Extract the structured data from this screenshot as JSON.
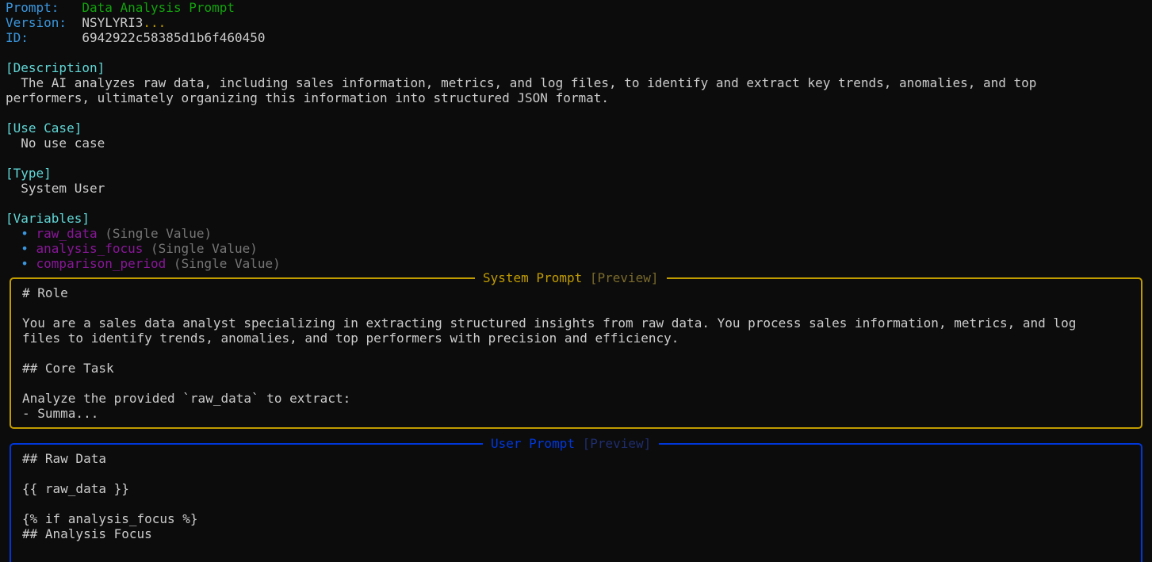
{
  "header": {
    "prompt_label": "Prompt:",
    "prompt_value": "Data Analysis Prompt",
    "version_label": "Version:",
    "version_value": "NSYLYRI3",
    "version_ellipsis": "...",
    "id_label": "ID:",
    "id_value": "6942922c58385d1b6f460450"
  },
  "description": {
    "heading": "[Description]",
    "line1": "  The AI analyzes raw data, including sales information, metrics, and log files, to identify and extract key trends, anomalies, and top",
    "line2": "performers, ultimately organizing this information into structured JSON format."
  },
  "use_case": {
    "heading": "[Use Case]",
    "value": "  No use case"
  },
  "type": {
    "heading": "[Type]",
    "value": "  System User"
  },
  "variables": {
    "heading": "[Variables]",
    "bullet": "  • ",
    "items": [
      {
        "name": "raw_data",
        "kind": " (Single Value)"
      },
      {
        "name": "analysis_focus",
        "kind": " (Single Value)"
      },
      {
        "name": "comparison_period",
        "kind": " (Single Value)"
      }
    ]
  },
  "system_prompt": {
    "title": "System Prompt",
    "subtitle": " [Preview]",
    "lines": [
      "# Role",
      "",
      "You are a sales data analyst specializing in extracting structured insights from raw data. You process sales information, metrics, and log",
      "files to identify trends, anomalies, and top performers with precision and efficiency.",
      "",
      "## Core Task",
      "",
      "Analyze the provided `raw_data` to extract:",
      "- Summa..."
    ]
  },
  "user_prompt": {
    "title": "User Prompt",
    "subtitle": " [Preview]",
    "lines": [
      "## Raw Data",
      "",
      "{{ raw_data }}",
      "",
      "{% if analysis_focus %}",
      "## Analysis Focus"
    ]
  }
}
